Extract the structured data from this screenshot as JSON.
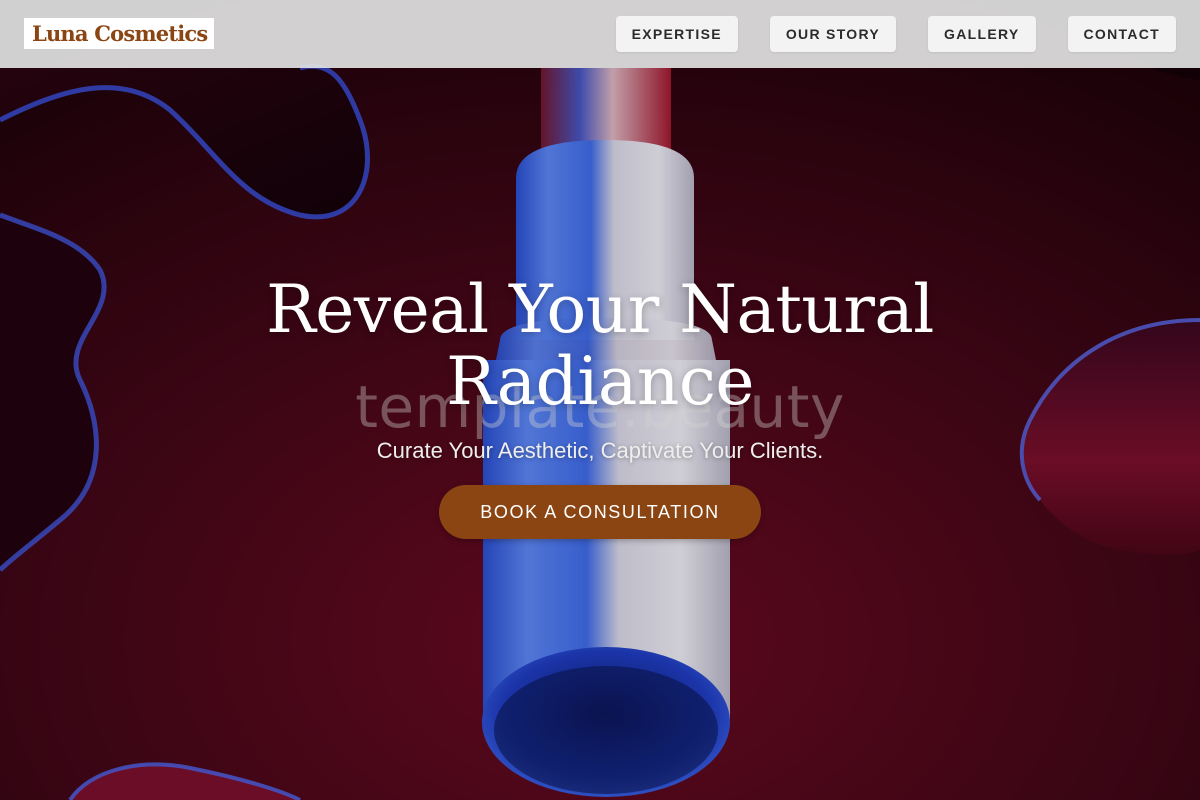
{
  "brand": {
    "name": "Luna Cosmetics",
    "accent_color": "#8b4513"
  },
  "nav": {
    "items": [
      {
        "label": "EXPERTISE"
      },
      {
        "label": "OUR STORY"
      },
      {
        "label": "GALLERY"
      },
      {
        "label": "CONTACT"
      }
    ]
  },
  "hero": {
    "headline": "Reveal Your Natural Radiance",
    "subheadline": "Curate Your Aesthetic, Captivate Your Clients.",
    "cta_label": "BOOK A CONSULTATION",
    "watermark": "template.beauty",
    "background_colors": {
      "base": "#3a0512",
      "product_blue": "#3b64e0",
      "product_white": "#e4e2ec"
    }
  }
}
